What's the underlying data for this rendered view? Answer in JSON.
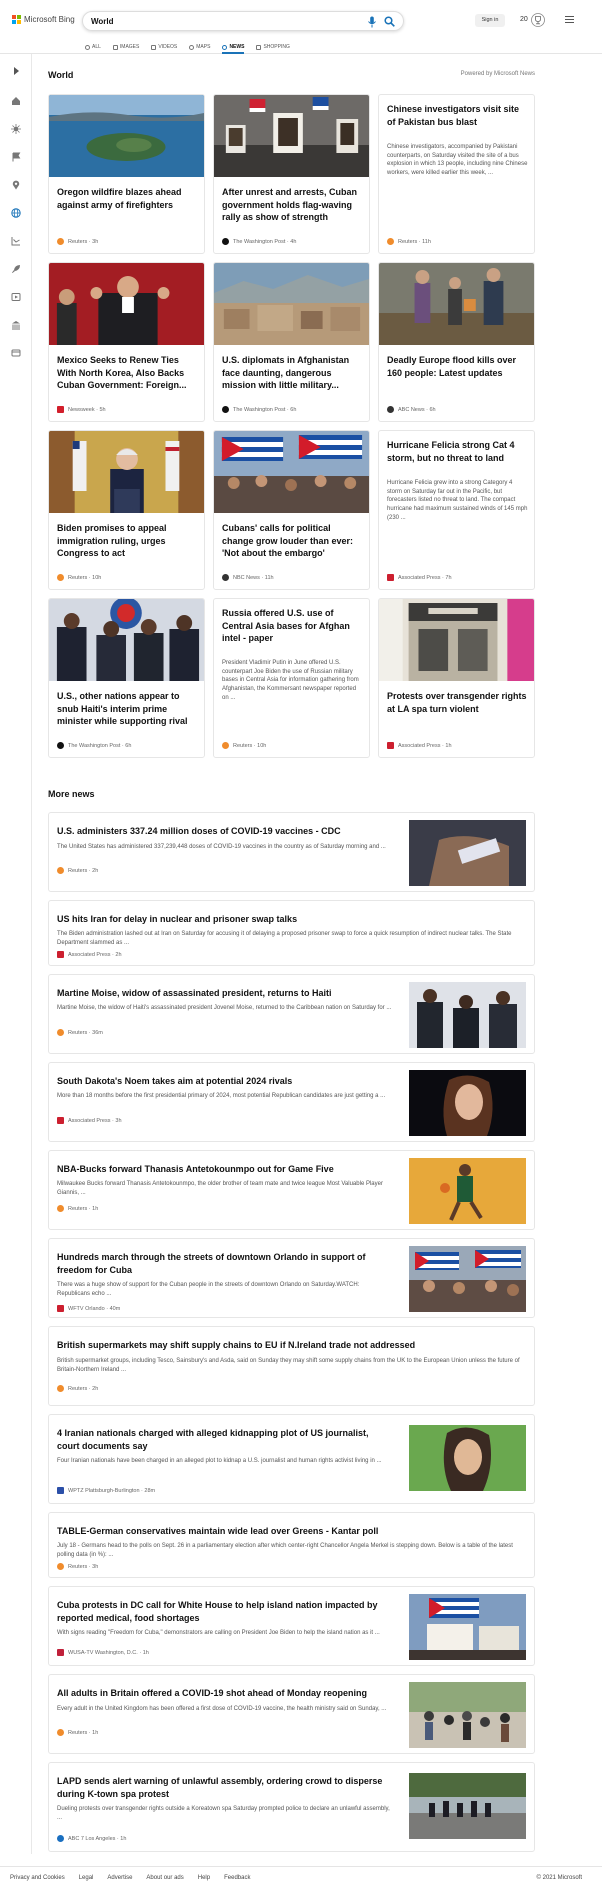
{
  "header": {
    "brand": "Microsoft Bing",
    "search_value": "World",
    "signin_label": "Sign in",
    "points": "20"
  },
  "tabs": [
    "ALL",
    "IMAGES",
    "VIDEOS",
    "MAPS",
    "NEWS",
    "SHOPPING"
  ],
  "active_tab": "NEWS",
  "section": {
    "title": "World",
    "powered_by": "Powered by Microsoft News"
  },
  "cards": [
    {
      "title": "Oregon wildfire blazes ahead against army of firefighters",
      "source": "Reuters",
      "age": "3h"
    },
    {
      "title": "After unrest and arrests, Cuban government holds flag-waving rally as show of strength",
      "source": "The Washington Post",
      "age": "4h"
    },
    {
      "title": "Chinese investigators visit site of Pakistan bus blast",
      "snippet": "Chinese investigators, accompanied by Pakistani counterparts, on Saturday visited the site of a bus explosion in which 13 people, including nine Chinese workers, were killed earlier this week, ...",
      "source": "Reuters",
      "age": "11h"
    },
    {
      "title": "Mexico Seeks to Renew Ties With North Korea, Also Backs Cuban Government: Foreign...",
      "source": "Newsweek",
      "age": "5h"
    },
    {
      "title": "U.S. diplomats in Afghanistan face daunting, dangerous mission with little military...",
      "source": "The Washington Post",
      "age": "6h"
    },
    {
      "title": "Deadly Europe flood kills over 160 people: Latest updates",
      "source": "ABC News",
      "age": "6h"
    },
    {
      "title": "Biden promises to appeal immigration ruling, urges Congress to act",
      "source": "Reuters",
      "age": "10h"
    },
    {
      "title": "Cubans' calls for political change grow louder than ever: 'Not about the embargo'",
      "source": "NBC News",
      "age": "11h"
    },
    {
      "title": "Hurricane Felicia strong Cat 4 storm, but no threat to land",
      "snippet": "Hurricane Felicia grew into a strong Category 4 storm on Saturday far out in the Pacific, but forecasters listed no threat to land. The compact hurricane had maximum sustained winds of 145 mph (230 ...",
      "source": "Associated Press",
      "age": "7h"
    },
    {
      "title": "U.S., other nations appear to snub Haiti's interim prime minister while supporting rival",
      "source": "The Washington Post",
      "age": "6h"
    },
    {
      "title": "Russia offered U.S. use of Central Asia bases for Afghan intel - paper",
      "snippet": "President Vladimir Putin in June offered U.S. counterpart Joe Biden the use of Russian military bases in Central Asia for information gathering from Afghanistan, the Kommersant newspaper reported on ...",
      "source": "Reuters",
      "age": "10h"
    },
    {
      "title": "Protests over transgender rights at LA spa turn violent",
      "source": "Associated Press",
      "age": "1h"
    }
  ],
  "more_news": {
    "title": "More news",
    "items": [
      {
        "title": "U.S. administers 337.24 million doses of COVID-19 vaccines - CDC",
        "snippet": "The United States has administered 337,239,448 doses of COVID-19 vaccines in the country as of Saturday morning and ...",
        "source": "Reuters",
        "age": "2h"
      },
      {
        "title": "US hits Iran for delay in nuclear and prisoner swap talks",
        "snippet": "The Biden administration lashed out at Iran on Saturday for accusing it of delaying a proposed prisoner swap to force a quick resumption of indirect nuclear talks. The State Department slammed as ...",
        "source": "Associated Press",
        "age": "2h"
      },
      {
        "title": "Martine Moise, widow of assassinated president, returns to Haiti",
        "snippet": "Martine Moise, the widow of Haiti's assassinated president Jovenel Moise, returned to the Caribbean nation on Saturday for ...",
        "source": "Reuters",
        "age": "36m"
      },
      {
        "title": "South Dakota's Noem takes aim at potential 2024 rivals",
        "snippet": "More than 18 months before the first presidential primary of 2024, most potential Republican candidates are just getting a ...",
        "source": "Associated Press",
        "age": "3h"
      },
      {
        "title": "NBA-Bucks forward Thanasis Antetokounmpo out for Game Five",
        "snippet": "Milwaukee Bucks forward Thanasis Antetokounmpo, the older brother of team mate and twice league Most Valuable Player Giannis, ...",
        "source": "Reuters",
        "age": "1h"
      },
      {
        "title": "Hundreds march through the streets of downtown Orlando in support of freedom for Cuba",
        "snippet": "There was a huge show of support for the Cuban people in the streets of downtown Orlando on Saturday.WATCH: Republicans echo ...",
        "source": "WFTV Orlando",
        "age": "40m"
      },
      {
        "title": "British supermarkets may shift supply chains to EU if N.Ireland trade not addressed",
        "snippet": "British supermarket groups, including Tesco, Sainsbury's and Asda, said on Sunday they may shift some supply chains from the UK to the European Union unless the future of Britain-Northern Ireland ...",
        "source": "Reuters",
        "age": "2h"
      },
      {
        "title": "4 Iranian nationals charged with alleged kidnapping plot of US journalist, court documents say",
        "snippet": "Four Iranian nationals have been charged in an alleged plot to kidnap a U.S. journalist and human rights activist living in ...",
        "source": "WPTZ Plattsburgh-Burlington",
        "age": "28m"
      },
      {
        "title": "TABLE-German conservatives maintain wide lead over Greens - Kantar poll",
        "snippet": "July 18 - Germans head to the polls on Sept. 26 in a parliamentary election after which center-right Chancellor Angela Merkel is stepping down. Below is a table of the latest polling data (in %): ...",
        "source": "Reuters",
        "age": "3h"
      },
      {
        "title": "Cuba protests in DC call for White House to help island nation impacted by reported medical, food shortages",
        "snippet": "With signs reading \"Freedom for Cuba,\" demonstrators are calling on President Joe Biden to help the island nation as it ...",
        "source": "WUSA-TV Washington, D.C.",
        "age": "1h"
      },
      {
        "title": "All adults in Britain offered a COVID-19 shot ahead of Monday reopening",
        "snippet": "Every adult in the United Kingdom has been offered a first dose of COVID-19 vaccine, the health ministry said on Sunday, ...",
        "source": "Reuters",
        "age": "1h"
      },
      {
        "title": "LAPD sends alert warning of unlawful assembly, ordering crowd to disperse during K-town spa protest",
        "snippet": "Dueling protests over transgender rights outside a Koreatown spa Saturday prompted police to declare an unlawful assembly, ...",
        "source": "ABC 7 Los Angeles",
        "age": "1h"
      }
    ]
  },
  "footer": {
    "links": [
      "Privacy and Cookies",
      "Legal",
      "Advertise",
      "About our ads",
      "Help",
      "Feedback"
    ],
    "copyright": "© 2021 Microsoft"
  },
  "colors": {
    "accent": "#1a73b8",
    "reuters": "#f08c2c",
    "washington_post": "#111111",
    "newsweek": "#d21e2b",
    "ap": "#cc1f2f"
  }
}
